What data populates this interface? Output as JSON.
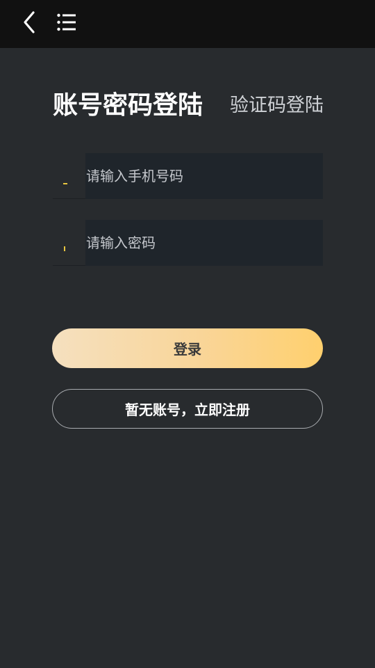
{
  "header": {
    "back_icon": "chevron-left-icon",
    "menu_icon": "list-menu-icon"
  },
  "tabs": {
    "password_login": "账号密码登陆",
    "code_login": "验证码登陆"
  },
  "form": {
    "phone_placeholder": "请输入手机号码",
    "phone_value": "",
    "password_placeholder": "请输入密码",
    "password_value": ""
  },
  "buttons": {
    "login": "登录",
    "register": "暂无账号，立即注册"
  },
  "colors": {
    "background": "#282b2e",
    "topbar": "#111111",
    "input_background": "#1f252b",
    "accent": "#e8c640",
    "login_gradient_start": "#f5e0bf",
    "login_gradient_end": "#ffd06e"
  }
}
